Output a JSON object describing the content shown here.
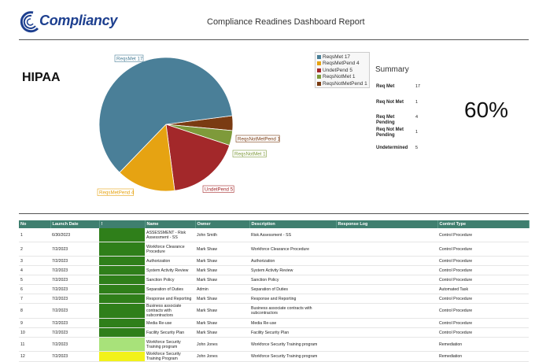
{
  "header": {
    "logo_text": "Compliancy",
    "report_title": "Compliance Readines Dashboard Report"
  },
  "framework": "HIPAA",
  "chart_data": {
    "type": "pie",
    "slices": [
      {
        "name": "ReqsMet",
        "value": 17,
        "label": "ReqsMet 17",
        "color": "#4a7f98"
      },
      {
        "name": "ReqsMetPend",
        "value": 4,
        "label": "ReqsMetPend 4",
        "color": "#e6a312"
      },
      {
        "name": "UndetPend",
        "value": 5,
        "label": "UndetPend 5",
        "color": "#a3282a"
      },
      {
        "name": "ReqsNotMet",
        "value": 1,
        "label": "ReqsNotMet 1",
        "color": "#7e9a3a"
      },
      {
        "name": "ReqsNotMetPend",
        "value": 1,
        "label": "ReqsNotMetPend 1",
        "color": "#7a3b12"
      }
    ],
    "legend": [
      "ReqsMet 17",
      "ReqsMetPend 4",
      "UndetPend 5",
      "ReqsNotMet 1",
      "ReqsNotMetPend 1"
    ],
    "legend_position": "right"
  },
  "summary": {
    "title": "Summary",
    "items": [
      {
        "label": "Req Met",
        "value": "17"
      },
      {
        "label": "Req Not Met",
        "value": "1"
      },
      {
        "label": "Req Met Pending",
        "value": "4"
      },
      {
        "label": "Req Not Met Pending",
        "value": "1"
      },
      {
        "label": "Undetermined",
        "value": "5"
      }
    ],
    "percent": "60%"
  },
  "table": {
    "headers": [
      "No",
      "Launch Date",
      "!",
      "Name",
      "Owner",
      "Description",
      "Response Log",
      "Control Type"
    ],
    "rows": [
      {
        "no": "1",
        "date": "6/30/2023",
        "status": "#2f7f1a",
        "name": "ASSESSMENT - Risk Assessment - SS",
        "owner": "John Smith",
        "desc": "Risk Assessment - SS",
        "log": "",
        "type": "Control Procedure",
        "tall": true
      },
      {
        "no": "2",
        "date": "7/2/2023",
        "status": "#2f7f1a",
        "name": "Workforce Clearance Procedure",
        "owner": "Mark Shaw",
        "desc": "Workforce Clearance Procedure",
        "log": "",
        "type": "Control Procedure",
        "tall": true
      },
      {
        "no": "3",
        "date": "7/2/2023",
        "status": "#2f7f1a",
        "name": "Authorization",
        "owner": "Mark Shaw",
        "desc": "Authorization",
        "log": "",
        "type": "Control Procedure",
        "tall": false
      },
      {
        "no": "4",
        "date": "7/2/2023",
        "status": "#2f7f1a",
        "name": "System Activity Review",
        "owner": "Mark Shaw",
        "desc": "System Activity Review",
        "log": "",
        "type": "Control Procedure",
        "tall": false
      },
      {
        "no": "5",
        "date": "7/2/2023",
        "status": "#2f7f1a",
        "name": "Sanction Policy",
        "owner": "Mark Shaw",
        "desc": "Sanction Policy",
        "log": "",
        "type": "Control Procedure",
        "tall": false
      },
      {
        "no": "6",
        "date": "7/2/2023",
        "status": "#2f7f1a",
        "name": "Separation of Duties",
        "owner": "Admin",
        "desc": "Separation of Duties",
        "log": "",
        "type": "Automated Task",
        "tall": false
      },
      {
        "no": "7",
        "date": "7/2/2023",
        "status": "#2f7f1a",
        "name": "Response and Reporting",
        "owner": "Mark Shaw",
        "desc": "Response and Reporting",
        "log": "",
        "type": "Control Procedure",
        "tall": false
      },
      {
        "no": "8",
        "date": "7/2/2023",
        "status": "#2f7f1a",
        "name": "Business associate contracts with subcontractors",
        "owner": "Mark Shaw",
        "desc": "Business associate contracts with subcontractors",
        "log": "",
        "type": "Control Procedure",
        "tall": true
      },
      {
        "no": "9",
        "date": "7/2/2023",
        "status": "#2f7f1a",
        "name": "Media Re-use",
        "owner": "Mark Shaw",
        "desc": "Media Re-use",
        "log": "",
        "type": "Control Procedure",
        "tall": false
      },
      {
        "no": "10",
        "date": "7/2/2023",
        "status": "#2f7f1a",
        "name": "Facility Security Plan",
        "owner": "Mark Shaw",
        "desc": "Facility Security Plan",
        "log": "",
        "type": "Control Procedure",
        "tall": false
      },
      {
        "no": "11",
        "date": "7/2/2023",
        "status": "#a8e27a",
        "name": "Workforce Security Training program",
        "owner": "John Jones",
        "desc": "Workforce Security Training program",
        "log": "",
        "type": "Remediation",
        "tall": true
      },
      {
        "no": "12",
        "date": "7/2/2023",
        "status": "#f2f21a",
        "name": "Workforce Security Training Program",
        "owner": "John Jones",
        "desc": "Workforce Security Training program",
        "log": "",
        "type": "Remediation",
        "tall": false
      }
    ]
  }
}
